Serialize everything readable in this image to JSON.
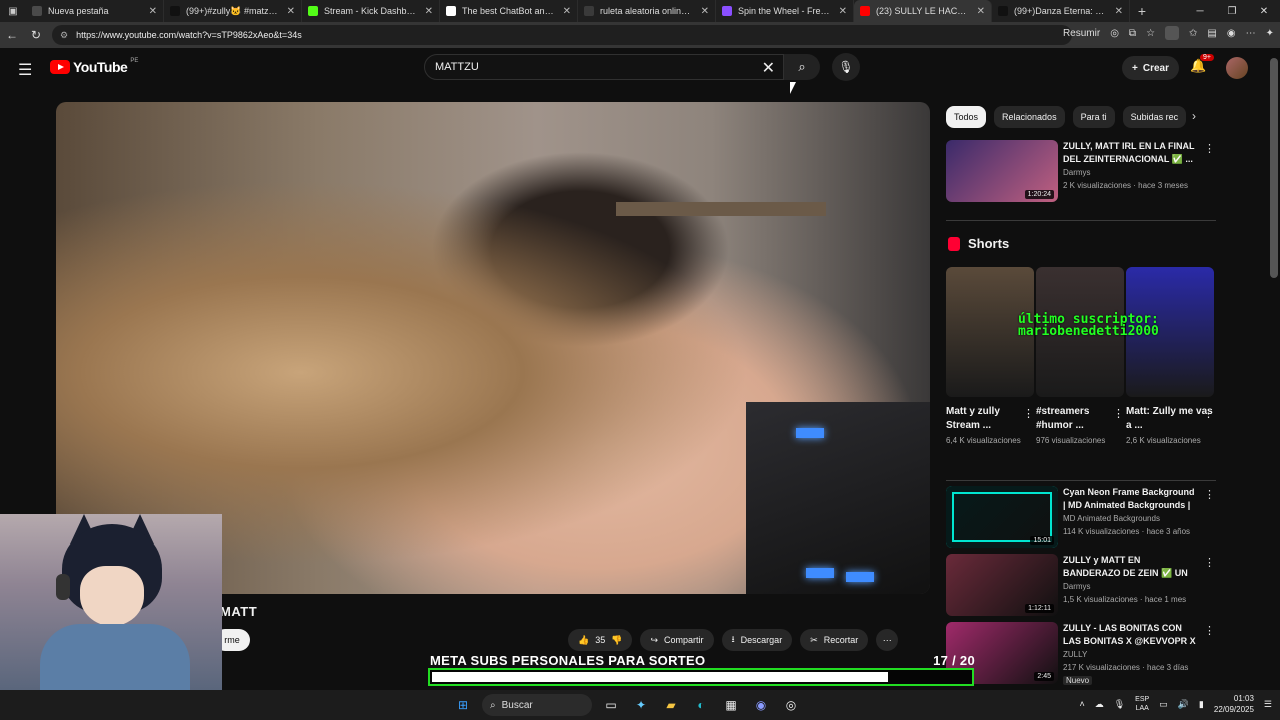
{
  "browser": {
    "tabs": [
      {
        "label": "Nueva pestaña",
        "color": "#4a4a4a"
      },
      {
        "label": "(99+)#zully🐱 #matzully #...",
        "color": "#111111"
      },
      {
        "label": "Stream - Kick Dashboard",
        "color": "#53fc18"
      },
      {
        "label": "The best ChatBot and Widg...",
        "color": "#ffffff"
      },
      {
        "label": "ruleta aleatoria online - Bú...",
        "color": "#3a3a3a"
      },
      {
        "label": "Spin the Wheel - Free and ...",
        "color": "#8a4fff"
      },
      {
        "label": "(23) SULLY LE HACE BA...",
        "color": "#ff0000"
      },
      {
        "label": "(99+)Danza Eterna: Movim...",
        "color": "#111111"
      }
    ],
    "url": "https://www.youtube.com/watch?v=sTP9862xAeo&t=34s",
    "resume_label": "Resumir"
  },
  "youtube": {
    "logo": "YouTube",
    "country": "PE",
    "search_value": "MATTZU",
    "create_label": "Crear",
    "notif_count": "9+",
    "video_title_fragment": "MATT",
    "subscribe_fragment": "rme",
    "actions": {
      "likes": "35",
      "share": "Compartir",
      "download": "Descargar",
      "clip": "Recortar"
    },
    "chips": [
      "Todos",
      "Relacionados",
      "Para ti",
      "Subidas rec"
    ],
    "shorts_title": "Shorts",
    "recs_top": [
      {
        "title": "ZULLY, MATT IRL EN LA FINAL DEL ZEINTERNACIONAL ✅ ...",
        "channel": "Darmys",
        "meta": "2 K visualizaciones · hace 3 meses",
        "duration": "1:20:24",
        "thumb": "#3a2a6a"
      }
    ],
    "shorts": [
      {
        "title": "Matt y zully Stream ...",
        "views": "6,4 K visualizaciones",
        "thumb": "#5a4a3a"
      },
      {
        "title": "#streamers #humor ...",
        "views": "976 visualizaciones",
        "thumb": "#3a3030"
      },
      {
        "title": "Matt: Zully me vas a ...",
        "views": "2,6 K visualizaciones",
        "thumb": "#2a2aa8"
      }
    ],
    "recs_bottom": [
      {
        "title": "Cyan Neon Frame Background | MD Animated Backgrounds | ...",
        "channel": "MD Animated Backgrounds",
        "meta": "114 K visualizaciones · hace 3 años",
        "duration": "15:01",
        "thumb": "#061a1a"
      },
      {
        "title": "ZULLY y MATT EN BANDERAZO DE ZEIN ✅ UN BAILE ...",
        "channel": "Darmys",
        "meta": "1,5 K visualizaciones · hace 1 mes",
        "duration": "1:12:11",
        "thumb": "#6a2a3a"
      },
      {
        "title": "ZULLY - LAS BONITAS CON LAS BONITAS X @KEVVOPR  X ...",
        "channel": "ZULLY",
        "meta": "217 K visualizaciones · hace 3 días",
        "duration": "2:45",
        "badge": "Nuevo",
        "thumb": "#a02a6a"
      }
    ]
  },
  "overlay": {
    "last_sub_line1": "último suscriptor:",
    "last_sub_line2": "mariobenedetti2000",
    "goal_label": "META SUBS PERSONALES PARA SORTEO",
    "goal_current": "17",
    "goal_target": "20",
    "goal_fraction": 0.85,
    "goal_display": "17 / 20"
  },
  "taskbar": {
    "search_label": "Buscar",
    "lang_line1": "ESP",
    "lang_line2": "LAA",
    "time": "01:03",
    "date": "22/09/2025"
  },
  "colors": {
    "yt_red": "#ff0000",
    "overlay_green": "#22dd22",
    "bg": "#0f0f0f"
  }
}
